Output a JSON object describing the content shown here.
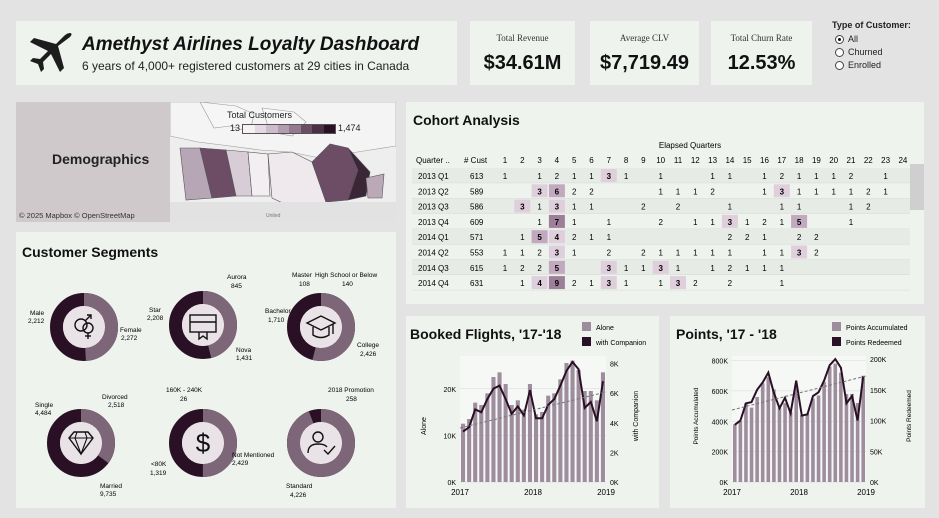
{
  "header": {
    "title": "Amethyst Airlines Loyalty Dashboard",
    "subtitle": "6 years of 4,000+ registered customers at 29 cities in Canada"
  },
  "kpis": [
    {
      "label": "Total Revenue",
      "value": "$34.61M"
    },
    {
      "label": "Average CLV",
      "value": "$7,719.49"
    },
    {
      "label": "Total Churn Rate",
      "value": "12.53%"
    }
  ],
  "filter": {
    "title": "Type of Customer:",
    "options": [
      {
        "label": "All",
        "selected": true
      },
      {
        "label": "Churned",
        "selected": false
      },
      {
        "label": "Enrolled",
        "selected": false
      }
    ]
  },
  "demographics": {
    "label": "Demographics",
    "attribution": "© 2025 Mapbox © OpenStreetMap",
    "map_caption": "United",
    "legend_title": "Total Customers",
    "legend_min": "13",
    "legend_max": "1,474"
  },
  "cohort": {
    "title": "Cohort Analysis",
    "elapsed_label": "Elapsed Quarters",
    "col_quarter": "Quarter ..",
    "col_cust": "# Cust",
    "quarters": [
      "1",
      "2",
      "3",
      "4",
      "5",
      "6",
      "7",
      "8",
      "9",
      "10",
      "11",
      "12",
      "13",
      "14",
      "15",
      "16",
      "17",
      "18",
      "19",
      "20",
      "21",
      "22",
      "23",
      "24"
    ],
    "rows": [
      {
        "q": "2013 Q1",
        "cust": "613",
        "cells": [
          "1",
          "",
          "1",
          "2",
          "1",
          "1",
          "3",
          "1",
          "",
          "1",
          "",
          "",
          "1",
          "1",
          "",
          "1",
          "2",
          "1",
          "1",
          "1",
          "2",
          "",
          "1",
          ""
        ]
      },
      {
        "q": "2013 Q2",
        "cust": "589",
        "cells": [
          "",
          "",
          "3",
          "6",
          "2",
          "2",
          "",
          "",
          "",
          "1",
          "1",
          "1",
          "2",
          "",
          "",
          "1",
          "3",
          "1",
          "1",
          "1",
          "1",
          "2",
          "1",
          ""
        ]
      },
      {
        "q": "2013 Q3",
        "cust": "586",
        "cells": [
          "",
          "3",
          "1",
          "3",
          "1",
          "1",
          "",
          "",
          "2",
          "",
          "2",
          "",
          "",
          "1",
          "",
          "",
          "1",
          "1",
          "",
          "",
          "1",
          "2",
          "",
          ""
        ]
      },
      {
        "q": "2013 Q4",
        "cust": "609",
        "cells": [
          "",
          "",
          "1",
          "7",
          "1",
          "",
          "1",
          "",
          "",
          "2",
          "",
          "1",
          "1",
          "3",
          "1",
          "2",
          "1",
          "5",
          "",
          "",
          "1",
          "",
          "",
          ""
        ]
      },
      {
        "q": "2014 Q1",
        "cust": "571",
        "cells": [
          "",
          "1",
          "5",
          "4",
          "2",
          "1",
          "1",
          "",
          "",
          "",
          "",
          "",
          "",
          "2",
          "2",
          "1",
          "",
          "2",
          "2",
          "",
          "",
          "",
          "",
          ""
        ]
      },
      {
        "q": "2014 Q2",
        "cust": "553",
        "cells": [
          "1",
          "1",
          "2",
          "3",
          "1",
          "",
          "2",
          "",
          "2",
          "1",
          "1",
          "1",
          "1",
          "1",
          "",
          "1",
          "1",
          "3",
          "2",
          "",
          "",
          "",
          "",
          ""
        ]
      },
      {
        "q": "2014 Q3",
        "cust": "615",
        "cells": [
          "1",
          "2",
          "2",
          "5",
          "",
          "",
          "3",
          "1",
          "1",
          "3",
          "1",
          "",
          "1",
          "2",
          "1",
          "1",
          "1",
          "",
          "",
          "",
          "",
          "",
          "",
          ""
        ]
      },
      {
        "q": "2014 Q4",
        "cust": "631",
        "cells": [
          "",
          "1",
          "4",
          "9",
          "2",
          "1",
          "3",
          "1",
          "",
          "1",
          "3",
          "2",
          "",
          "2",
          "",
          "",
          "1",
          "",
          "",
          "",
          "",
          "",
          "",
          ""
        ]
      }
    ]
  },
  "segments": {
    "title": "Customer Segments",
    "donuts": [
      {
        "icon": "gender-icon",
        "share": 0.49,
        "labels": [
          {
            "name": "Male",
            "value": "2,212"
          },
          {
            "name": "Female",
            "value": "2,272"
          }
        ]
      },
      {
        "icon": "card-icon",
        "share": 0.46,
        "labels": [
          {
            "name": "Aurora",
            "value": "845"
          },
          {
            "name": "Star",
            "value": "2,208"
          },
          {
            "name": "Nova",
            "value": "1,431"
          }
        ]
      },
      {
        "icon": "education-icon",
        "share": 0.54,
        "labels": [
          {
            "name": "Master",
            "value": "108"
          },
          {
            "name": "High School or Below",
            "value": "140"
          },
          {
            "name": "Bachelor",
            "value": "1,710"
          },
          {
            "name": "College",
            "value": "2,426"
          }
        ]
      },
      {
        "icon": "diamond-icon",
        "share": 0.35,
        "labels": [
          {
            "name": "Divorced",
            "value": "2,518"
          },
          {
            "name": "Single",
            "value": "4,484"
          },
          {
            "name": "Married",
            "value": "9,735"
          }
        ]
      },
      {
        "icon": "dollar-icon",
        "share": 0.5,
        "labels": [
          {
            "name": "160K - 240K",
            "value": "26"
          },
          {
            "name": "<80K",
            "value": "1,319"
          },
          {
            "name": "Not Mentioned",
            "value": "2,429"
          }
        ]
      },
      {
        "icon": "user-check-icon",
        "share": 0.94,
        "labels": [
          {
            "name": "2018 Promotion",
            "value": "258"
          },
          {
            "name": "Standard",
            "value": "4,226"
          }
        ]
      }
    ]
  },
  "booked": {
    "title": "Booked Flights, '17-'18",
    "legend": [
      {
        "name": "Alone",
        "color": "#9e8d9d"
      },
      {
        "name": "with Companion",
        "color": "#2a1024"
      }
    ],
    "y_left_label": "Alone",
    "y_right_label": "with Companion",
    "y_left_ticks": [
      "0K",
      "10K",
      "20K"
    ],
    "y_right_ticks": [
      "0K",
      "2K",
      "4K",
      "6K",
      "8K"
    ],
    "x_ticks": [
      "2017",
      "2018",
      "2019"
    ]
  },
  "points": {
    "title": "Points, '17 - '18",
    "legend": [
      {
        "name": "Points Accumulated",
        "color": "#9e8d9d"
      },
      {
        "name": "Points Redeemed",
        "color": "#2a1024"
      }
    ],
    "y_left_label": "Points Accumulated",
    "y_right_label": "Points Redeemed",
    "y_left_ticks": [
      "0K",
      "200K",
      "400K",
      "600K",
      "800K"
    ],
    "y_right_ticks": [
      "0K",
      "50K",
      "100K",
      "150K",
      "200K"
    ],
    "x_ticks": [
      "2017",
      "2018",
      "2019"
    ]
  },
  "chart_data": [
    {
      "type": "bar",
      "title": "Booked Flights, '17-'18",
      "xlabel": "",
      "ylabel": "Alone",
      "y2label": "with Companion",
      "ylim": [
        0,
        27000
      ],
      "y2lim": [
        0,
        8500
      ],
      "x": [
        "2017-01",
        "2017-02",
        "2017-03",
        "2017-04",
        "2017-05",
        "2017-06",
        "2017-07",
        "2017-08",
        "2017-09",
        "2017-10",
        "2017-11",
        "2017-12",
        "2018-01",
        "2018-02",
        "2018-03",
        "2018-04",
        "2018-05",
        "2018-06",
        "2018-07",
        "2018-08",
        "2018-09",
        "2018-10",
        "2018-11",
        "2018-12"
      ],
      "series": [
        {
          "name": "Alone",
          "type": "bar",
          "values": [
            12500,
            13500,
            17000,
            16500,
            19000,
            22500,
            23500,
            21000,
            16500,
            17500,
            15500,
            21000,
            14500,
            15000,
            18500,
            19000,
            22000,
            25500,
            26000,
            24000,
            19500,
            19500,
            17500,
            23500
          ]
        },
        {
          "name": "with Companion",
          "type": "line",
          "values": [
            3400,
            3700,
            4900,
            4700,
            5600,
            6300,
            6500,
            5600,
            4600,
            5100,
            4500,
            6200,
            4300,
            4300,
            5200,
            5600,
            6500,
            7500,
            8100,
            7600,
            5000,
            5400,
            4100,
            6800
          ]
        }
      ]
    },
    {
      "type": "bar",
      "title": "Points, '17 - '18",
      "xlabel": "",
      "ylabel": "Points Accumulated",
      "y2label": "Points Redeemed",
      "ylim": [
        0,
        830000
      ],
      "y2lim": [
        0,
        205000
      ],
      "x": [
        "2017-01",
        "2017-02",
        "2017-03",
        "2017-04",
        "2017-05",
        "2017-06",
        "2017-07",
        "2017-08",
        "2017-09",
        "2017-10",
        "2017-11",
        "2017-12",
        "2018-01",
        "2018-02",
        "2018-03",
        "2018-04",
        "2018-05",
        "2018-06",
        "2018-07",
        "2018-08",
        "2018-09",
        "2018-10",
        "2018-11",
        "2018-12"
      ],
      "series": [
        {
          "name": "Points Accumulated",
          "type": "bar",
          "values": [
            380000,
            400000,
            520000,
            490000,
            560000,
            650000,
            690000,
            610000,
            490000,
            520000,
            460000,
            620000,
            440000,
            450000,
            550000,
            570000,
            660000,
            760000,
            780000,
            720000,
            580000,
            580000,
            520000,
            700000
          ]
        },
        {
          "name": "Points Redeemed",
          "type": "line",
          "values": [
            93000,
            100000,
            128000,
            130000,
            150000,
            162000,
            178000,
            145000,
            120000,
            137000,
            112000,
            165000,
            108000,
            110000,
            140000,
            146000,
            165000,
            190000,
            200000,
            186000,
            128000,
            140000,
            100000,
            172000
          ]
        }
      ]
    }
  ]
}
